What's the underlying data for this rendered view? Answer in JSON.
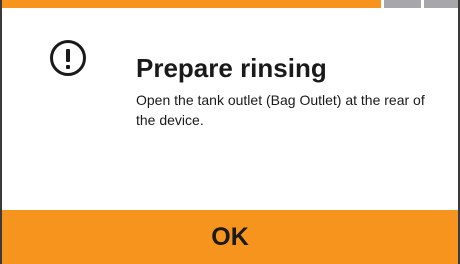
{
  "dialog": {
    "title": "Prepare rinsing",
    "message": "Open the tank outlet (Bag Outlet) at the rear of the device.",
    "icon": "exclamation-circle-icon",
    "ok_label": "OK"
  },
  "colors": {
    "accent": "#f7941d",
    "progress_inactive": "#a7a7ab",
    "text": "#1a1a1a",
    "background": "#ffffff",
    "frame_border": "#3a3a3a"
  }
}
